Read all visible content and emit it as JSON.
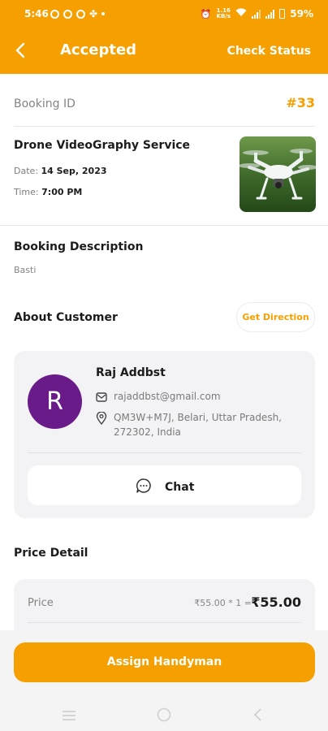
{
  "status_bar": {
    "time": "5:46",
    "data_speed": "1.16\nKB/s",
    "battery": "59%"
  },
  "app_bar": {
    "title": "Accepted",
    "action": "Check Status"
  },
  "booking": {
    "id_label": "Booking ID",
    "id_value": "#33",
    "service_name": "Drone VideoGraphy Service",
    "date_label": "Date:",
    "date_value": "14 Sep, 2023",
    "time_label": "Time:",
    "time_value": "7:00 PM"
  },
  "description": {
    "title": "Booking Description",
    "text": "Basti"
  },
  "customer": {
    "section_title": "About Customer",
    "direction_button": "Get Direction",
    "initial": "R",
    "name": "Raj Addbst",
    "email": "rajaddbst@gmail.com",
    "address": "QM3W+M7J, Belari, Uttar Pradesh, 272302, India",
    "chat_button": "Chat"
  },
  "price": {
    "section_title": "Price Detail",
    "label": "Price",
    "formula": "₹55.00 * 1  =",
    "total": "₹55.00"
  },
  "footer": {
    "assign_button": "Assign Handyman"
  },
  "colors": {
    "accent": "#f5a000",
    "avatar": "#6a1b8a"
  }
}
